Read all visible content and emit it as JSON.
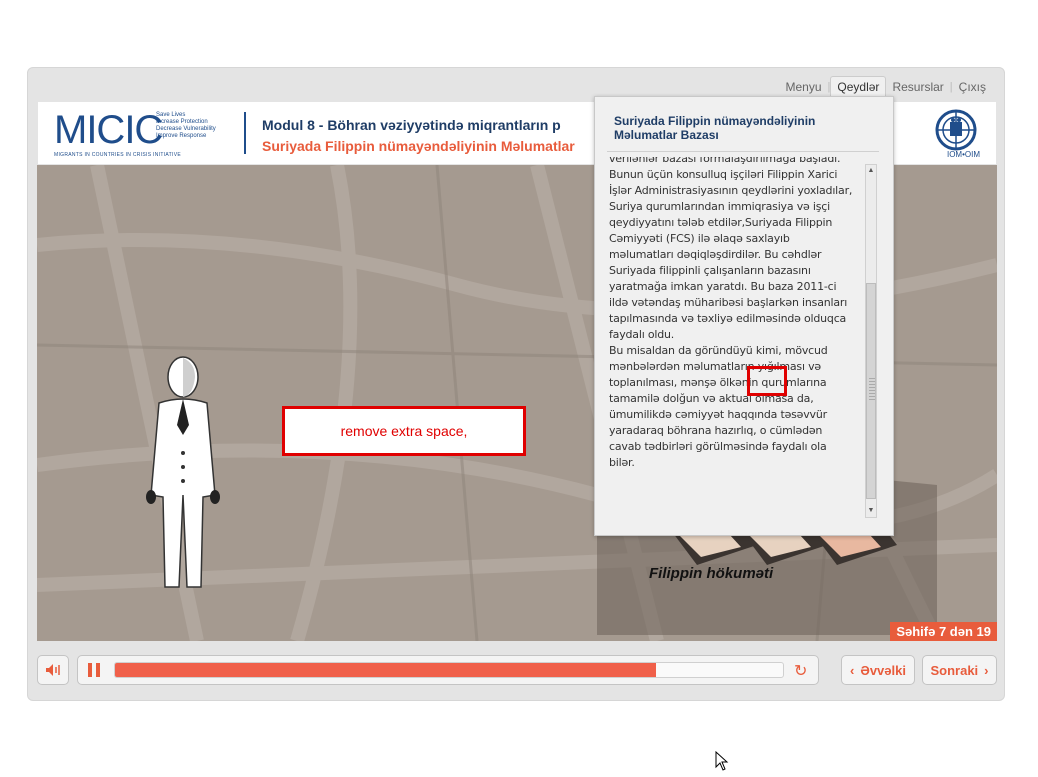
{
  "nav": {
    "items": [
      {
        "label": "Menyu",
        "active": false
      },
      {
        "label": "Qeydlər",
        "active": true
      },
      {
        "label": "Resurslar",
        "active": false
      },
      {
        "label": "Çıxış",
        "active": false
      }
    ]
  },
  "header": {
    "logo_text": "MICIC",
    "logo_tagline": [
      "Save Lives",
      "Increase Protection",
      "Decrease Vulnerability",
      "Improve Response"
    ],
    "logo_subtitle": "MIGRANTS IN COUNTRIES IN CRISIS INITIATIVE",
    "module_title": "Modul 8 - Böhran vəziyyətində miqrantların p",
    "page_title": "Suriyada Filippin nümayəndəliyinin Məlumatlar",
    "iom_label": "IOM•OIM"
  },
  "stage": {
    "annotation_text": "remove extra space,",
    "flag_caption": "Filippin hökuməti",
    "page_indicator": "Səhifə 7 dən 19"
  },
  "notes": {
    "title": "Suriyada Filippin nümayəndəliyinin Məlumatlar Bazası",
    "lines": [
      "verilənlər bazası formalaşdırılmağa başladı.",
      "Bunun üçün konsulluq işçiləri Filippin Xarici",
      "İşlər Administrasiyasının qeydlərini yoxladılar,",
      "Suriya qurumlarından immiqrasiya və işçi",
      "qeydiyyatını tələb etdilər,Suriyada Filippin",
      "Cəmiyyəti (FCS) ilə əlaqə saxlayıb",
      "məlumatları dəqiqləşdirdilər. Bu cəhdlər",
      "Suriyada filippinli çalışanların bazasını",
      "yaratmağa imkan yaratdı. Bu baza 2011-ci",
      "ildə vətəndaş müharibəsi başlarkən insanları",
      "tapılmasında və təxliyə edilməsində olduqca",
      "faydalı oldu.",
      "Bu misaldan da göründüyü kimi, mövcud",
      "mənbələrdən məlumatların yığılması və",
      "toplanılması, mənşə ölkənin  qurumlarına",
      "tamamilə dolğun və aktual olmasa da,",
      "ümumilikdə cəmiyyət haqqında təsəvvür",
      "yaradaraq böhrana hazırlıq, o cümlədən",
      "cavab tədbirləri görülməsində faydalı ola",
      "bilər."
    ]
  },
  "controls": {
    "progress_percent": 81,
    "prev_label": "Əvvəlki",
    "next_label": "Sonraki"
  },
  "colors": {
    "accent": "#e85c3c",
    "navy": "#1f3d66",
    "annotation_red": "#e00000"
  }
}
